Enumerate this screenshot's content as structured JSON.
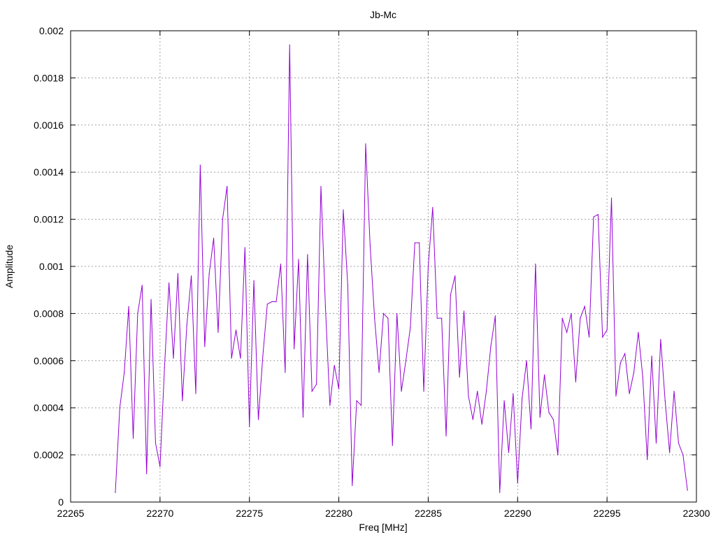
{
  "chart_data": {
    "type": "line",
    "title": "Jb-Mc",
    "xlabel": "Freq [MHz]",
    "ylabel": "Amplitude",
    "xlim": [
      22265,
      22300
    ],
    "ylim": [
      0,
      0.002
    ],
    "xticks": [
      "22265",
      "22270",
      "22275",
      "22280",
      "22285",
      "22290",
      "22295",
      "22300"
    ],
    "yticks": [
      "0",
      "0.0002",
      "0.0004",
      "0.0006",
      "0.0008",
      "0.001",
      "0.0012",
      "0.0014",
      "0.0016",
      "0.0018",
      "0.002"
    ],
    "grid": true,
    "line_color": "#9400d3",
    "series": [
      {
        "x": [
          22267.5,
          22267.75,
          22268.0,
          22268.25,
          22268.5,
          22268.75,
          22269.0,
          22269.25,
          22269.5,
          22269.75,
          22270.0,
          22270.25,
          22270.5,
          22270.75,
          22271.0,
          22271.25,
          22271.5,
          22271.75,
          22272.0,
          22272.25,
          22272.5,
          22272.75,
          22273.0,
          22273.25,
          22273.5,
          22273.75,
          22274.0,
          22274.25,
          22274.5,
          22274.75,
          22275.0,
          22275.25,
          22275.5,
          22275.75,
          22276.0,
          22276.25,
          22276.5,
          22276.75,
          22277.0,
          22277.25,
          22277.5,
          22277.75,
          22278.0,
          22278.25,
          22278.5,
          22278.75,
          22279.0,
          22279.25,
          22279.5,
          22279.75,
          22280.0,
          22280.25,
          22280.5,
          22280.75,
          22281.0,
          22281.25,
          22281.5,
          22281.75,
          22282.0,
          22282.25,
          22282.5,
          22282.75,
          22283.0,
          22283.25,
          22283.5,
          22283.75,
          22284.0,
          22284.25,
          22284.5,
          22284.75,
          22285.0,
          22285.25,
          22285.5,
          22285.75,
          22286.0,
          22286.25,
          22286.5,
          22286.75,
          22287.0,
          22287.25,
          22287.5,
          22287.75,
          22288.0,
          22288.25,
          22288.5,
          22288.75,
          22289.0,
          22289.25,
          22289.5,
          22289.75,
          22290.0,
          22290.25,
          22290.5,
          22290.75,
          22291.0,
          22291.25,
          22291.5,
          22291.75,
          22292.0,
          22292.25,
          22292.5,
          22292.75,
          22293.0,
          22293.25,
          22293.5,
          22293.75,
          22294.0,
          22294.25,
          22294.5,
          22294.75,
          22295.0,
          22295.25,
          22295.5,
          22295.75,
          22296.0,
          22296.25,
          22296.5,
          22296.75,
          22297.0,
          22297.25,
          22297.5,
          22297.75,
          22298.0,
          22298.25,
          22298.5,
          22298.75,
          22299.0,
          22299.25,
          22299.5
        ],
        "values": [
          4e-05,
          0.0004,
          0.00055,
          0.00083,
          0.00027,
          0.0008,
          0.00092,
          0.00012,
          0.00086,
          0.00025,
          0.00015,
          0.00057,
          0.00093,
          0.00061,
          0.00097,
          0.00043,
          0.00075,
          0.00096,
          0.00046,
          0.00143,
          0.00066,
          0.00097,
          0.00112,
          0.00072,
          0.0012,
          0.00134,
          0.00061,
          0.00073,
          0.00061,
          0.00108,
          0.00032,
          0.00094,
          0.00035,
          0.00062,
          0.00084,
          0.00085,
          0.00085,
          0.00101,
          0.00055,
          0.00194,
          0.00065,
          0.00103,
          0.00036,
          0.00105,
          0.00047,
          0.0005,
          0.00134,
          0.00083,
          0.00041,
          0.00058,
          0.00048,
          0.00124,
          0.00092,
          7e-05,
          0.00043,
          0.00041,
          0.00152,
          0.00109,
          0.00078,
          0.00055,
          0.0008,
          0.00078,
          0.00024,
          0.0008,
          0.00047,
          0.0006,
          0.00074,
          0.0011,
          0.0011,
          0.00047,
          0.001,
          0.00125,
          0.00078,
          0.00078,
          0.00028,
          0.00088,
          0.00096,
          0.00053,
          0.00081,
          0.00045,
          0.00035,
          0.00047,
          0.00033,
          0.00047,
          0.00066,
          0.00079,
          4e-05,
          0.00043,
          0.00021,
          0.00046,
          8e-05,
          0.00044,
          0.0006,
          0.00031,
          0.00101,
          0.00036,
          0.00054,
          0.00038,
          0.00035,
          0.0002,
          0.00078,
          0.00072,
          0.0008,
          0.00051,
          0.00078,
          0.00083,
          0.0007,
          0.00121,
          0.00122,
          0.0007,
          0.00073,
          0.00129,
          0.00045,
          0.00059,
          0.00063,
          0.00046,
          0.00055,
          0.00072,
          0.00053,
          0.00018,
          0.00062,
          0.00025,
          0.00069,
          0.00043,
          0.00021,
          0.00047,
          0.00025,
          0.0002,
          5e-05
        ]
      }
    ]
  }
}
